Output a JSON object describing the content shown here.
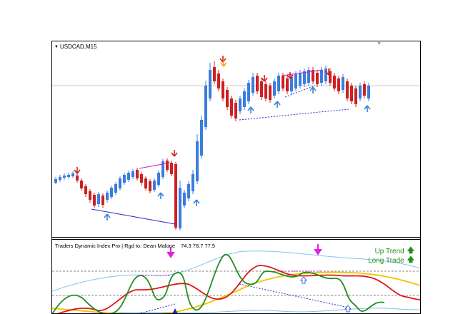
{
  "chart": {
    "symbol": "USDCAD,M15",
    "dropdown_icon": "triangle-down-icon",
    "candle_colors": {
      "bull": "#3b7ddd",
      "bear": "#d01f1f",
      "signal_orange": "#f5a31a"
    }
  },
  "indicator": {
    "title": "Traders Dynamic Index Pro | Rgd to: Dean Malone",
    "values": "74.3 78.7 77.5",
    "legend": [
      {
        "label": "Up Trend",
        "icon": "arrow-up-icon",
        "color": "#1f8f1f"
      },
      {
        "label": "Long Trade",
        "icon": "arrow-up-icon",
        "color": "#1f8f1f"
      }
    ]
  }
}
